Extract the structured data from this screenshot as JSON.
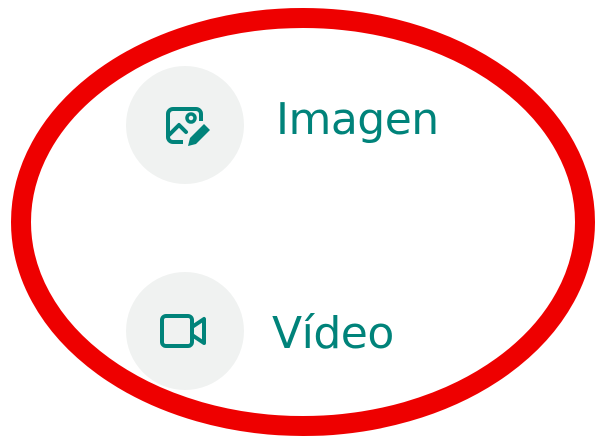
{
  "menu": {
    "items": [
      {
        "label": "Imagen",
        "icon": "image-edit-icon"
      },
      {
        "label": "Vídeo",
        "icon": "video-camera-icon"
      }
    ]
  },
  "colors": {
    "accent": "#00837a",
    "icon_background": "#f0f2f1",
    "annotation": "#ee0000"
  }
}
